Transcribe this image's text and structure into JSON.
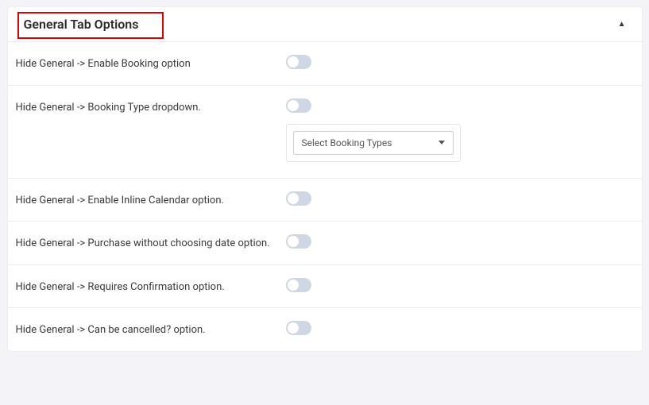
{
  "section": {
    "title": "General Tab Options"
  },
  "rows": {
    "enable_booking": {
      "label": "Hide General -> Enable Booking option"
    },
    "booking_type": {
      "label": "Hide General -> Booking Type dropdown.",
      "select_placeholder": "Select Booking Types"
    },
    "inline_calendar": {
      "label": "Hide General -> Enable Inline Calendar option."
    },
    "purchase_without_date": {
      "label": "Hide General -> Purchase without choosing date option."
    },
    "requires_confirmation": {
      "label": "Hide General -> Requires Confirmation option."
    },
    "can_be_cancelled": {
      "label": "Hide General -> Can be cancelled? option."
    }
  }
}
